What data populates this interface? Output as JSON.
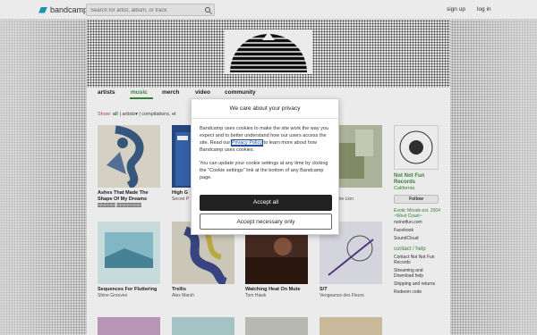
{
  "header": {
    "logo_text": "bandcamp",
    "search_placeholder": "Search for artist, album, or track",
    "signup": "sign up",
    "login": "log in"
  },
  "nav": {
    "tabs": [
      {
        "label": "artists"
      },
      {
        "label": "music"
      },
      {
        "label": "merch"
      },
      {
        "label": "video"
      },
      {
        "label": "community"
      }
    ],
    "active": "music"
  },
  "filters": {
    "show_label": "Show:",
    "all_label": "all",
    "artists_label": "artists",
    "compilations_label": "compilations, et"
  },
  "releases": [
    {
      "title": "Ashes That Made The Shape Of My Dreams",
      "artist": "🀫🀫🀫🀫🀫 🀫🀫🀫🀫🀫🀫🀫"
    },
    {
      "title": "High G",
      "artist": "Secret P"
    },
    {
      "title": "INDLE",
      "artist": "aces Of The Lion"
    },
    {
      "title": "Sequences For Fluttering",
      "artist": "Shine Grooves"
    },
    {
      "title": "Trellis",
      "artist": "Alex Marsh"
    },
    {
      "title": "Watching Heat On Mute",
      "artist": "Tom Hawk"
    },
    {
      "title": "S/T",
      "artist": "Vengeance des Fleurs"
    }
  ],
  "sidebar": {
    "name": "Not Not Fun Records",
    "location": "California",
    "follow": "Follow",
    "bio": "Exotic Moods est. 2004 ~West Coast~",
    "links": [
      "notnotfun.com",
      "Facebook",
      "SoundCloud"
    ],
    "contact_heading": "contact / help",
    "contact_items": [
      "Contact Not Not Fun Records",
      "Streaming and Download help",
      "Shipping and returns",
      "Redeem code"
    ]
  },
  "modal": {
    "heading": "We care about your privacy",
    "body_pre": "Bandcamp uses cookies to make the site work the way you expect and to better understand how our users access the site. Read our",
    "privacy_link": "Privacy Policy",
    "body_post": "to learn more about how Bandcamp uses cookies.",
    "body2": "You can update your cookie settings at any time by clicking the \"Cookie settings\" link at the bottom of any Bandcamp page.",
    "accept_all": "Accept all",
    "accept_necessary": "Accept necessary only"
  }
}
